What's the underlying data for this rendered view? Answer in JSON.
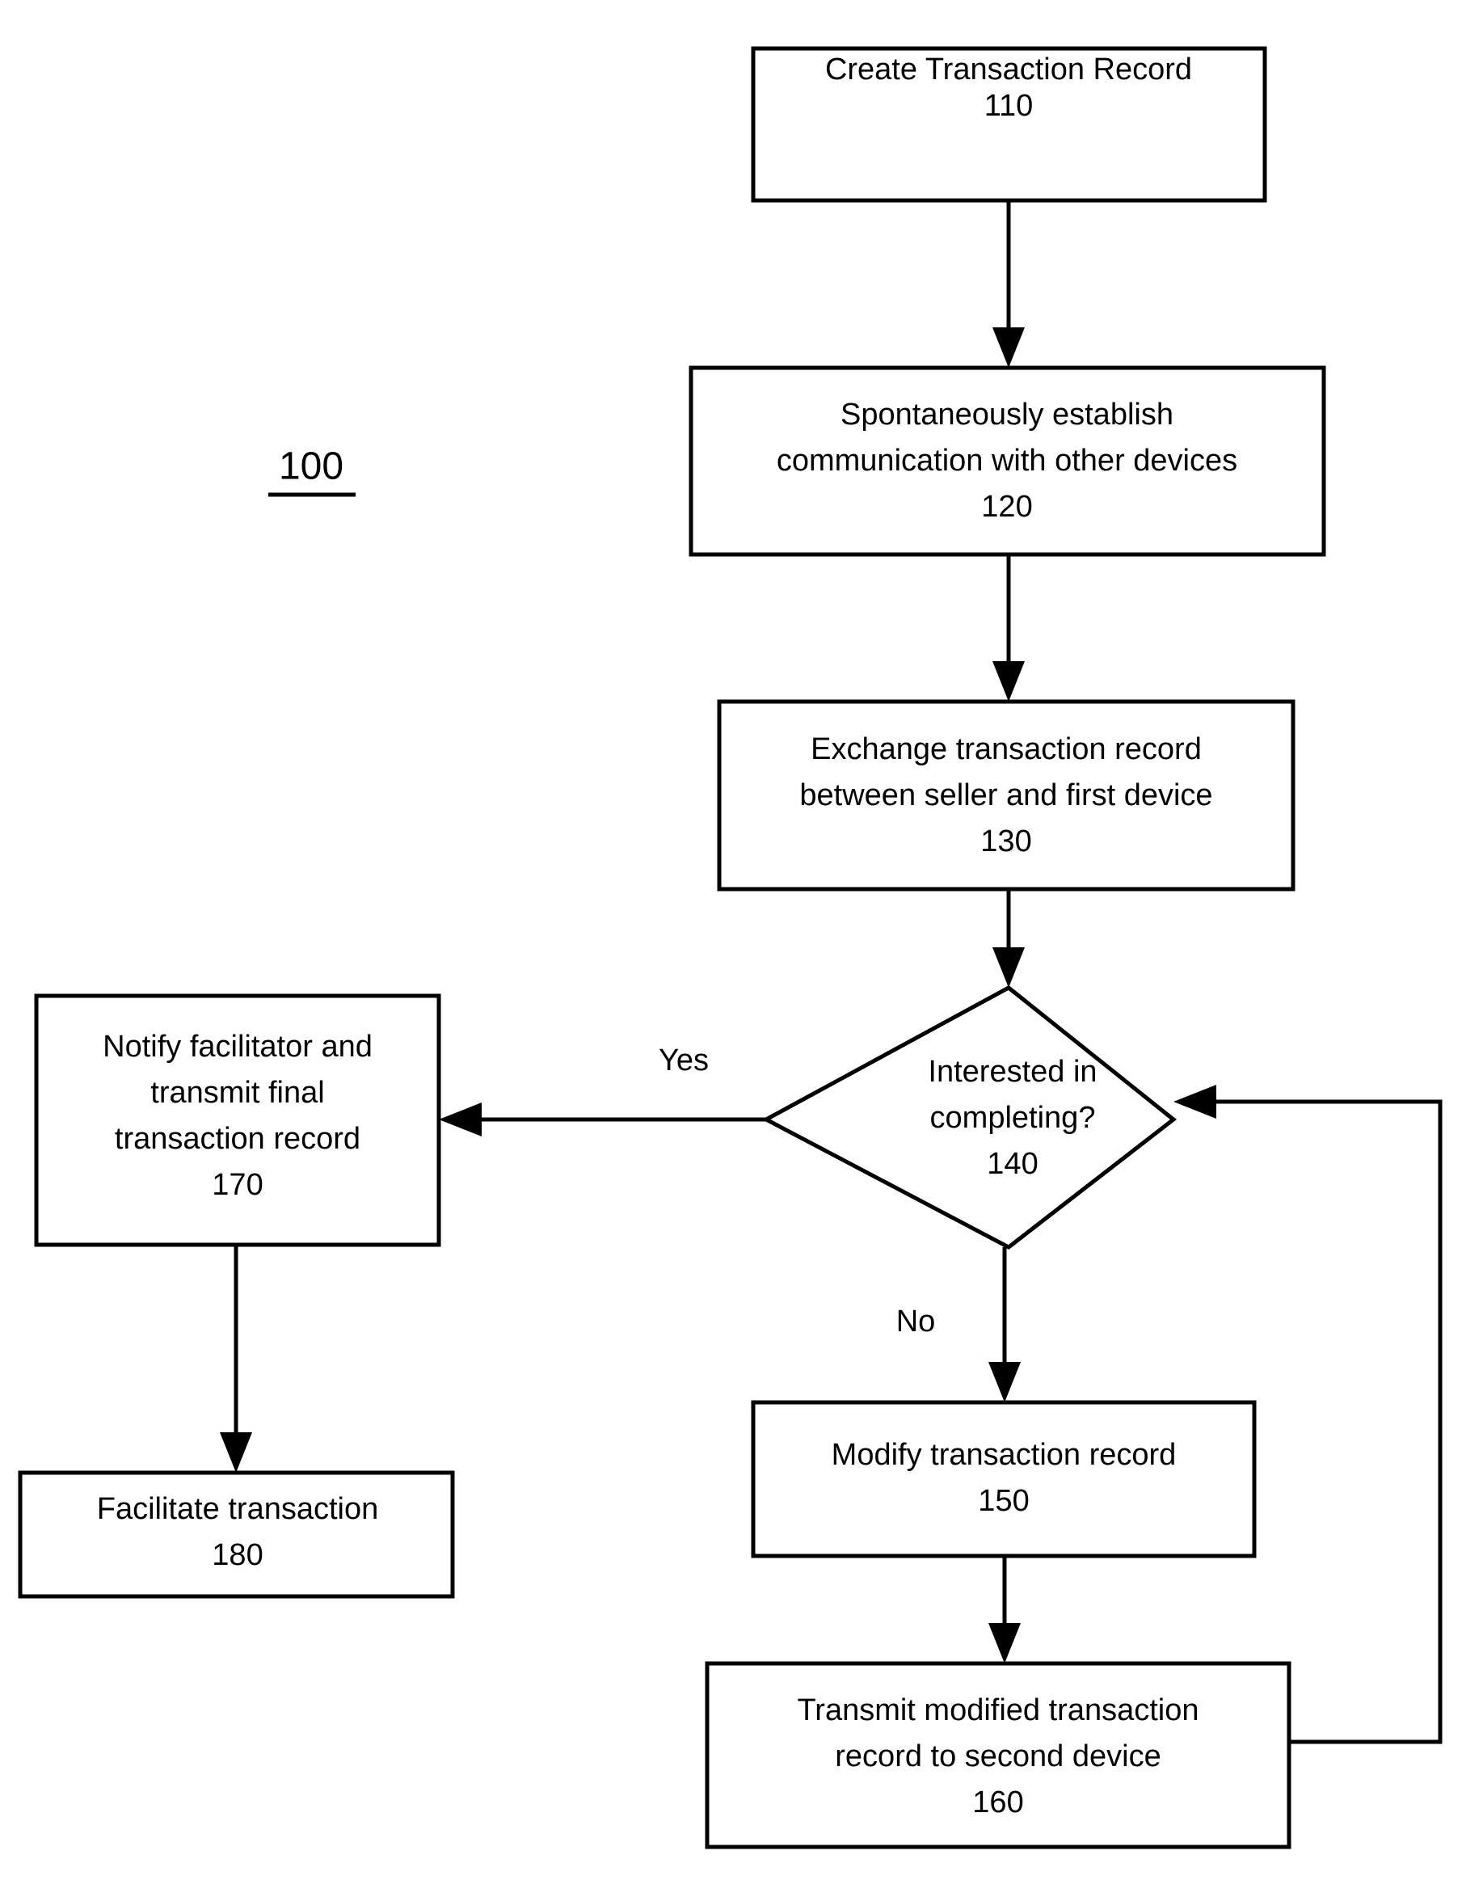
{
  "figure": {
    "number": "100",
    "underlined": true
  },
  "colors": {
    "stroke": "#000000",
    "fill": "#ffffff",
    "background": "#ffffff"
  },
  "diagram": {
    "type": "flowchart",
    "nodes": [
      {
        "id": "110",
        "shape": "rectangle",
        "lines": [
          "Create Transaction Record",
          "110"
        ],
        "line1": "Create Transaction Record",
        "ref": "110"
      },
      {
        "id": "120",
        "shape": "rectangle",
        "lines": [
          "Spontaneously establish",
          "communication with other devices",
          "120"
        ],
        "line1": "Spontaneously establish",
        "line2": "communication with other devices",
        "ref": "120"
      },
      {
        "id": "130",
        "shape": "rectangle",
        "lines": [
          "Exchange transaction record",
          "between seller and first device",
          "130"
        ],
        "line1": "Exchange transaction record",
        "line2": "between seller and first device",
        "ref": "130"
      },
      {
        "id": "140",
        "shape": "diamond",
        "lines": [
          "Interested in",
          "completing?",
          "140"
        ],
        "line1": "Interested in",
        "line2": "completing?",
        "ref": "140"
      },
      {
        "id": "150",
        "shape": "rectangle",
        "lines": [
          "Modify transaction record",
          "150"
        ],
        "line1": "Modify transaction record",
        "ref": "150"
      },
      {
        "id": "160",
        "shape": "rectangle",
        "lines": [
          "Transmit modified transaction",
          "record to second device",
          "160"
        ],
        "line1": "Transmit modified transaction",
        "line2": "record to second device",
        "ref": "160"
      },
      {
        "id": "170",
        "shape": "rectangle",
        "lines": [
          "Notify facilitator and",
          "transmit final",
          "transaction record",
          "170"
        ],
        "line1": "Notify facilitator and",
        "line2": "transmit final",
        "line3": "transaction record",
        "ref": "170"
      },
      {
        "id": "180",
        "shape": "rectangle",
        "lines": [
          "Facilitate transaction",
          "180"
        ],
        "line1": "Facilitate transaction",
        "ref": "180"
      }
    ],
    "edges": [
      {
        "from": "110",
        "to": "120",
        "label": ""
      },
      {
        "from": "120",
        "to": "130",
        "label": ""
      },
      {
        "from": "130",
        "to": "140",
        "label": ""
      },
      {
        "from": "140",
        "to": "170",
        "label": "Yes"
      },
      {
        "from": "140",
        "to": "150",
        "label": "No"
      },
      {
        "from": "150",
        "to": "160",
        "label": ""
      },
      {
        "from": "160",
        "to": "140",
        "label": ""
      },
      {
        "from": "170",
        "to": "180",
        "label": ""
      }
    ],
    "edge_labels": {
      "yes": "Yes",
      "no": "No"
    }
  }
}
